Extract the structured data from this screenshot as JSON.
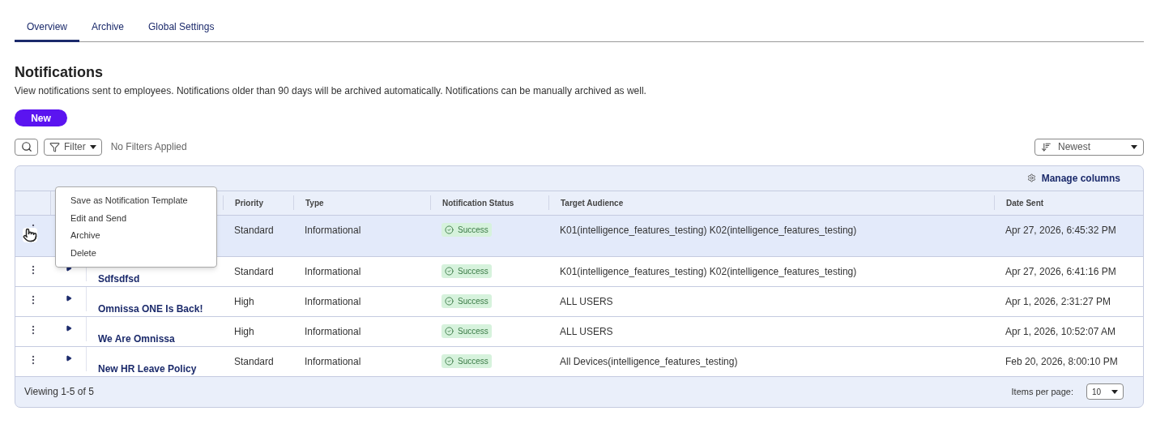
{
  "tabs": [
    {
      "label": "Overview",
      "selected": true
    },
    {
      "label": "Archive",
      "selected": false
    },
    {
      "label": "Global Settings",
      "selected": false
    }
  ],
  "heading": "Notifications",
  "description": "View notifications sent to employees. Notifications older than 90 days will be archived automatically. Notifications can be manually archived as well.",
  "new_button": "New",
  "filter": {
    "label": "Filter",
    "status": "No Filters Applied"
  },
  "sort": {
    "value": "Newest"
  },
  "manage_columns": "Manage columns",
  "columns": [
    "Priority",
    "Type",
    "Notification Status",
    "Target Audience",
    "Date Sent"
  ],
  "rows": [
    {
      "selected": true,
      "priority": "Standard",
      "type": "Informational",
      "status": "Success",
      "audience": "K01(intelligence_features_testing) K02(intelligence_features_testing)",
      "date": "Apr 27, 2026, 6:45:32 PM"
    },
    {
      "selected": false,
      "title": "Sdfsdfsd",
      "priority": "Standard",
      "type": "Informational",
      "status": "Success",
      "audience": "K01(intelligence_features_testing) K02(intelligence_features_testing)",
      "date": "Apr 27, 2026, 6:41:16 PM"
    },
    {
      "selected": false,
      "title": "Omnissa ONE Is Back!",
      "priority": "High",
      "type": "Informational",
      "status": "Success",
      "audience": "ALL USERS",
      "date": "Apr 1, 2026, 2:31:27 PM"
    },
    {
      "selected": false,
      "title": "We Are Omnissa",
      "priority": "High",
      "type": "Informational",
      "status": "Success",
      "audience": "ALL USERS",
      "date": "Apr 1, 2026, 10:52:07 AM"
    },
    {
      "selected": false,
      "title": "New HR Leave Policy",
      "priority": "Standard",
      "type": "Informational",
      "status": "Success",
      "audience": "All Devices(intelligence_features_testing)",
      "date": "Feb 20, 2026, 8:00:10 PM"
    }
  ],
  "context_menu": [
    "Save as Notification Template",
    "Edit and Send",
    "Archive",
    "Delete"
  ],
  "footer": {
    "viewing": "Viewing 1-5 of 5",
    "items_per_page_label": "Items per page:",
    "items_per_page": "10"
  }
}
